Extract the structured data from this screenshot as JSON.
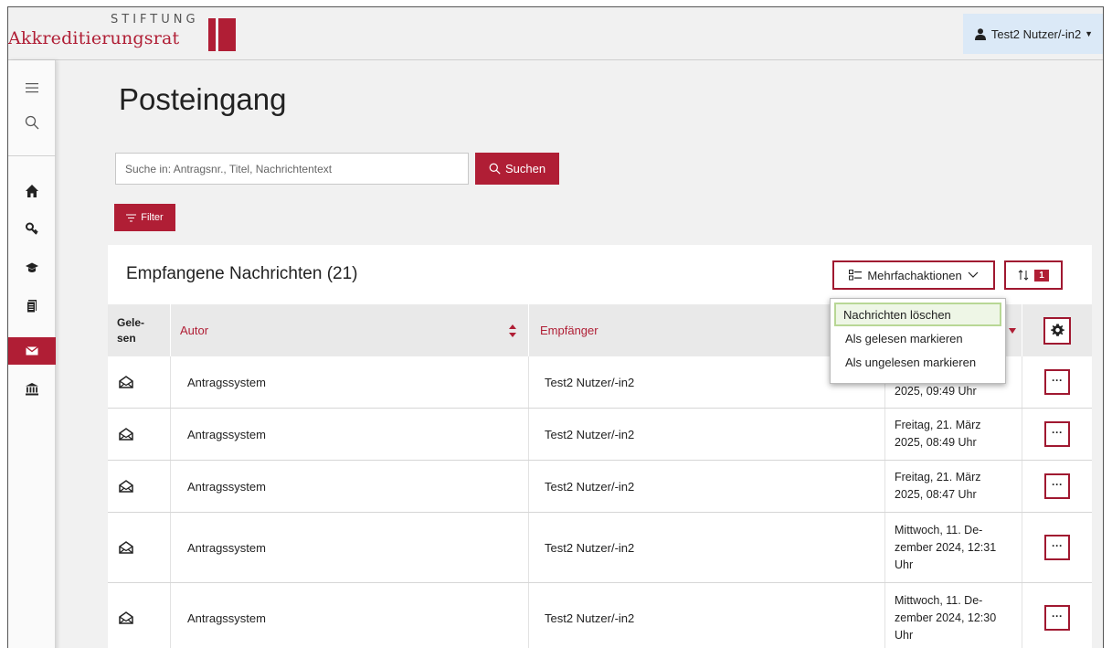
{
  "brand": {
    "top": "STIFTUNG",
    "bottom": "Akkreditierungsrat",
    "color": "#b01e35"
  },
  "user": {
    "name": "Test2 Nutzer/-in2"
  },
  "sidebar": {
    "items": [
      {
        "icon": "menu-icon"
      },
      {
        "icon": "search-icon"
      },
      {
        "icon": "home-icon"
      },
      {
        "icon": "keys-icon"
      },
      {
        "icon": "graduation-cap-icon"
      },
      {
        "icon": "documents-icon"
      },
      {
        "icon": "mail-icon",
        "active": true
      },
      {
        "icon": "institution-icon"
      }
    ]
  },
  "page": {
    "title": "Posteingang"
  },
  "search": {
    "placeholder": "Suche in: Antragsnr., Titel, Nachrichtentext",
    "button": "Suchen"
  },
  "filter": {
    "button": "Filter"
  },
  "panel": {
    "title": "Empfangene Nachrichten (21)",
    "multi_actions": "Mehrfachaktionen",
    "sort_badge": "1"
  },
  "dropdown": {
    "items": [
      "Nachrichten löschen",
      "Als gelesen markieren",
      "Als ungelesen markieren"
    ]
  },
  "table": {
    "headers": {
      "gelesen": "Gele-\nsen",
      "autor": "Autor",
      "empfaenger": "Empfänger"
    },
    "rows": [
      {
        "autor": "Antragssystem",
        "empfaenger": "Test2 Nutzer/-in2",
        "datum": "2025, 09:49 Uhr"
      },
      {
        "autor": "Antragssystem",
        "empfaenger": "Test2 Nutzer/-in2",
        "datum": "Freitag, 21. März 2025, 08:49 Uhr"
      },
      {
        "autor": "Antragssystem",
        "empfaenger": "Test2 Nutzer/-in2",
        "datum": "Freitag, 21. März 2025, 08:47 Uhr"
      },
      {
        "autor": "Antragssystem",
        "empfaenger": "Test2 Nutzer/-in2",
        "datum": "Mittwoch, 11. De-\nzember 2024, 12:31 Uhr"
      },
      {
        "autor": "Antragssystem",
        "empfaenger": "Test2 Nutzer/-in2",
        "datum": "Mittwoch, 11. De-\nzember 2024, 12:30 Uhr"
      }
    ]
  }
}
